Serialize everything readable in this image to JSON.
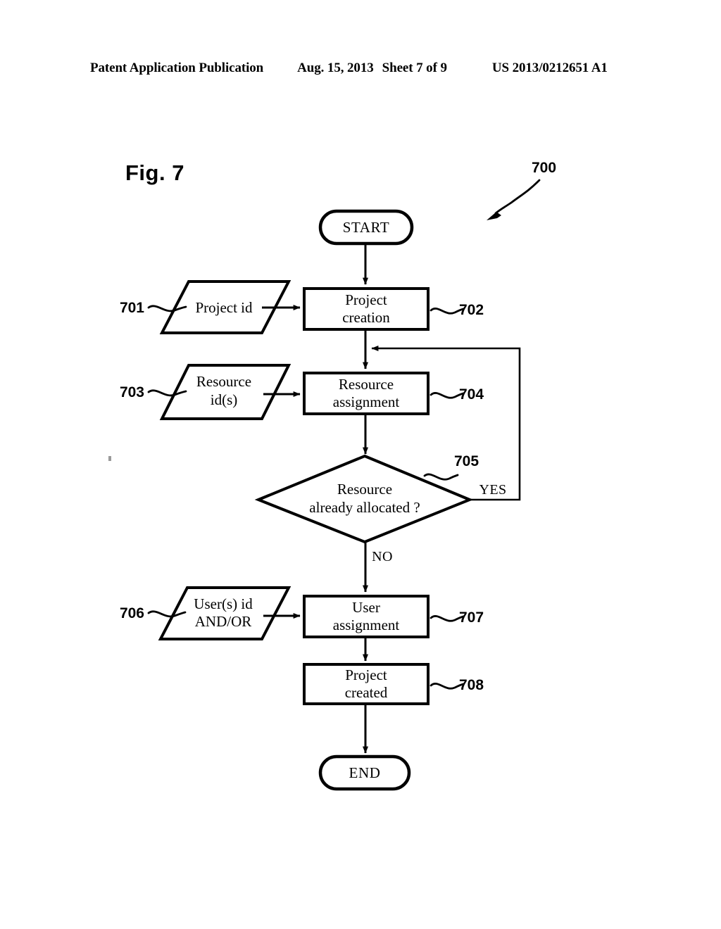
{
  "header": {
    "publication": "Patent Application Publication",
    "date": "Aug. 15, 2013",
    "sheet": "Sheet 7 of 9",
    "patent_number": "US 2013/0212651 A1"
  },
  "figure": {
    "label": "Fig. 7",
    "diagram_ref": "700"
  },
  "flowchart": {
    "nodes": {
      "start": {
        "text": "START",
        "shape": "terminal"
      },
      "n701": {
        "text": "Project id",
        "shape": "parallelogram",
        "ref": "701"
      },
      "n702": {
        "text_line1": "Project",
        "text_line2": "creation",
        "shape": "process",
        "ref": "702"
      },
      "n703": {
        "text_line1": "Resource",
        "text_line2": "id(s)",
        "shape": "parallelogram",
        "ref": "703"
      },
      "n704": {
        "text_line1": "Resource",
        "text_line2": "assignment",
        "shape": "process",
        "ref": "704"
      },
      "n705": {
        "text_line1": "Resource",
        "text_line2": "already allocated ?",
        "shape": "decision",
        "ref": "705"
      },
      "n706": {
        "text_line1": "User(s) id",
        "text_line2": "AND/OR",
        "shape": "parallelogram",
        "ref": "706"
      },
      "n707": {
        "text_line1": "User",
        "text_line2": "assignment",
        "shape": "process",
        "ref": "707"
      },
      "n708": {
        "text_line1": "Project",
        "text_line2": "created",
        "shape": "process",
        "ref": "708"
      },
      "end": {
        "text": "END",
        "shape": "terminal"
      }
    },
    "branch_labels": {
      "yes": "YES",
      "no": "NO"
    }
  },
  "colors": {
    "ink": "#000000",
    "paper": "#ffffff"
  }
}
